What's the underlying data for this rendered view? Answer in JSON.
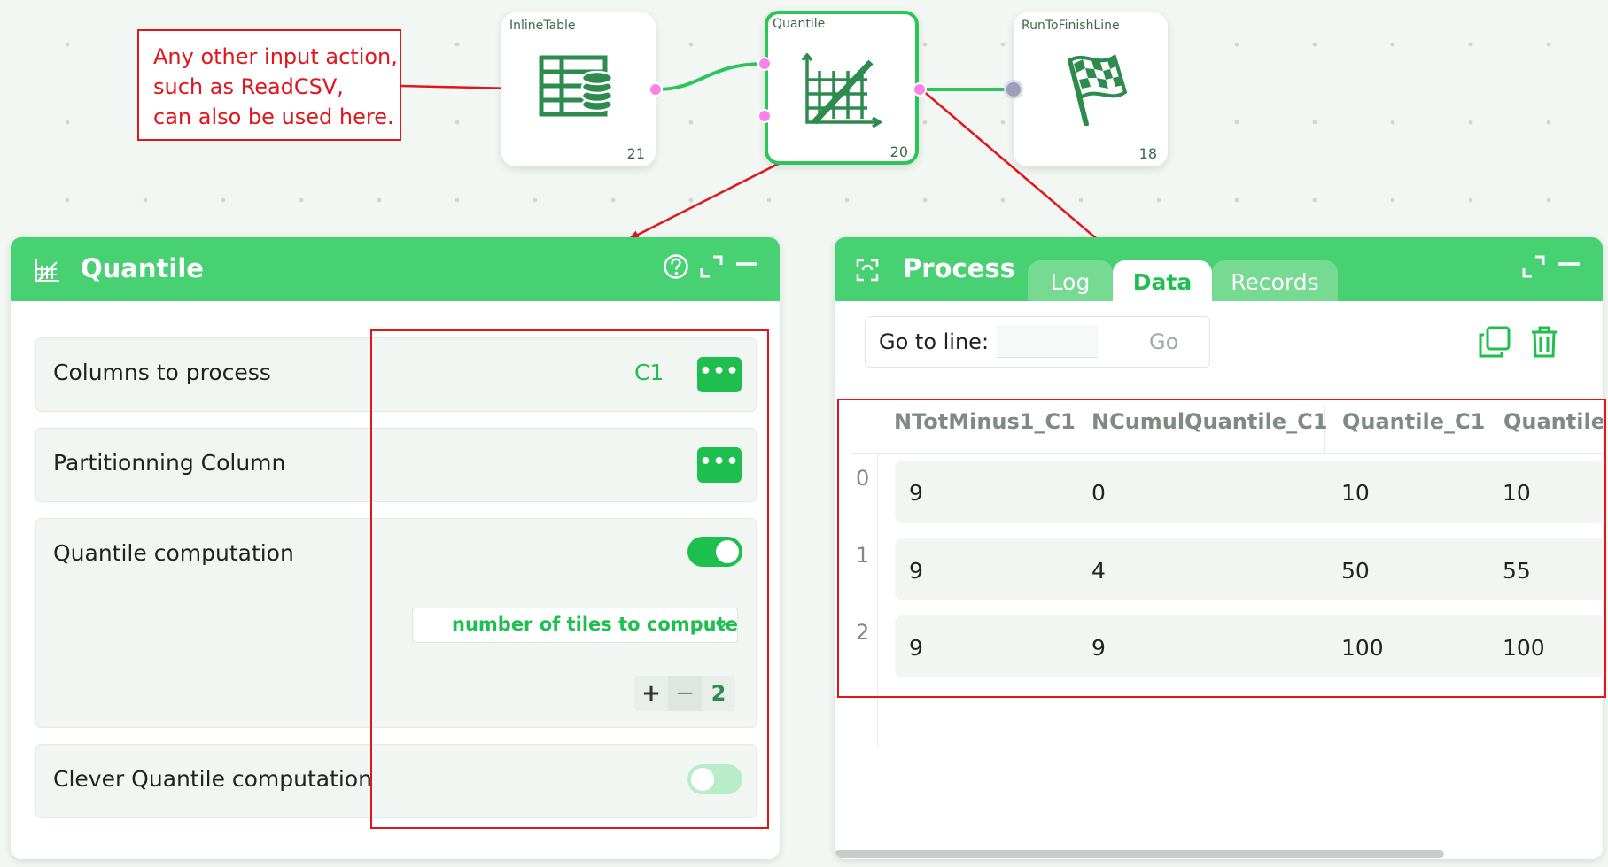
{
  "canvas": {
    "annotation_lines": [
      "Any other input action,",
      " such as ReadCSV,",
      " can also be used here."
    ],
    "nodes": [
      {
        "title": "InlineTable",
        "count": "21",
        "icon": "inline-table-icon"
      },
      {
        "title": "Quantile",
        "count": "20",
        "icon": "quantile-chart-icon"
      },
      {
        "title": "RunToFinishLine",
        "count": "18",
        "icon": "checkered-flag-icon"
      }
    ]
  },
  "quantile_panel": {
    "title": "Quantile",
    "rows": {
      "columns_to_process": {
        "label": "Columns to process",
        "value": "C1",
        "button": "•••"
      },
      "partitionning": {
        "label": "Partitionning Column",
        "button": "•••"
      },
      "quantile_computation": {
        "label": "Quantile computation",
        "enabled": true,
        "mode": "number of tiles to compute",
        "plus": "+",
        "minus": "−",
        "tiles": "2"
      },
      "clever": {
        "label": "Clever Quantile computation",
        "enabled": false
      }
    }
  },
  "process_panel": {
    "title": "Process",
    "tabs": [
      "Log",
      "Data",
      "Records"
    ],
    "active_tab": "Data",
    "goto": {
      "label": "Go to line:",
      "value": "",
      "button": "Go"
    },
    "table": {
      "columns": [
        "NTotMinus1_C1",
        "NCumulQuantile_C1",
        "Quantile_C1",
        "QuantileI"
      ],
      "rows": [
        {
          "index": "0",
          "cells": [
            "9",
            "0",
            "10",
            "10"
          ]
        },
        {
          "index": "1",
          "cells": [
            "9",
            "4",
            "50",
            "55"
          ]
        },
        {
          "index": "2",
          "cells": [
            "9",
            "9",
            "100",
            "100"
          ]
        }
      ]
    }
  },
  "colors": {
    "accent": "#47d173",
    "button": "#1fbf4f",
    "annotation": "#e0161c",
    "port": "#ff80e8"
  }
}
